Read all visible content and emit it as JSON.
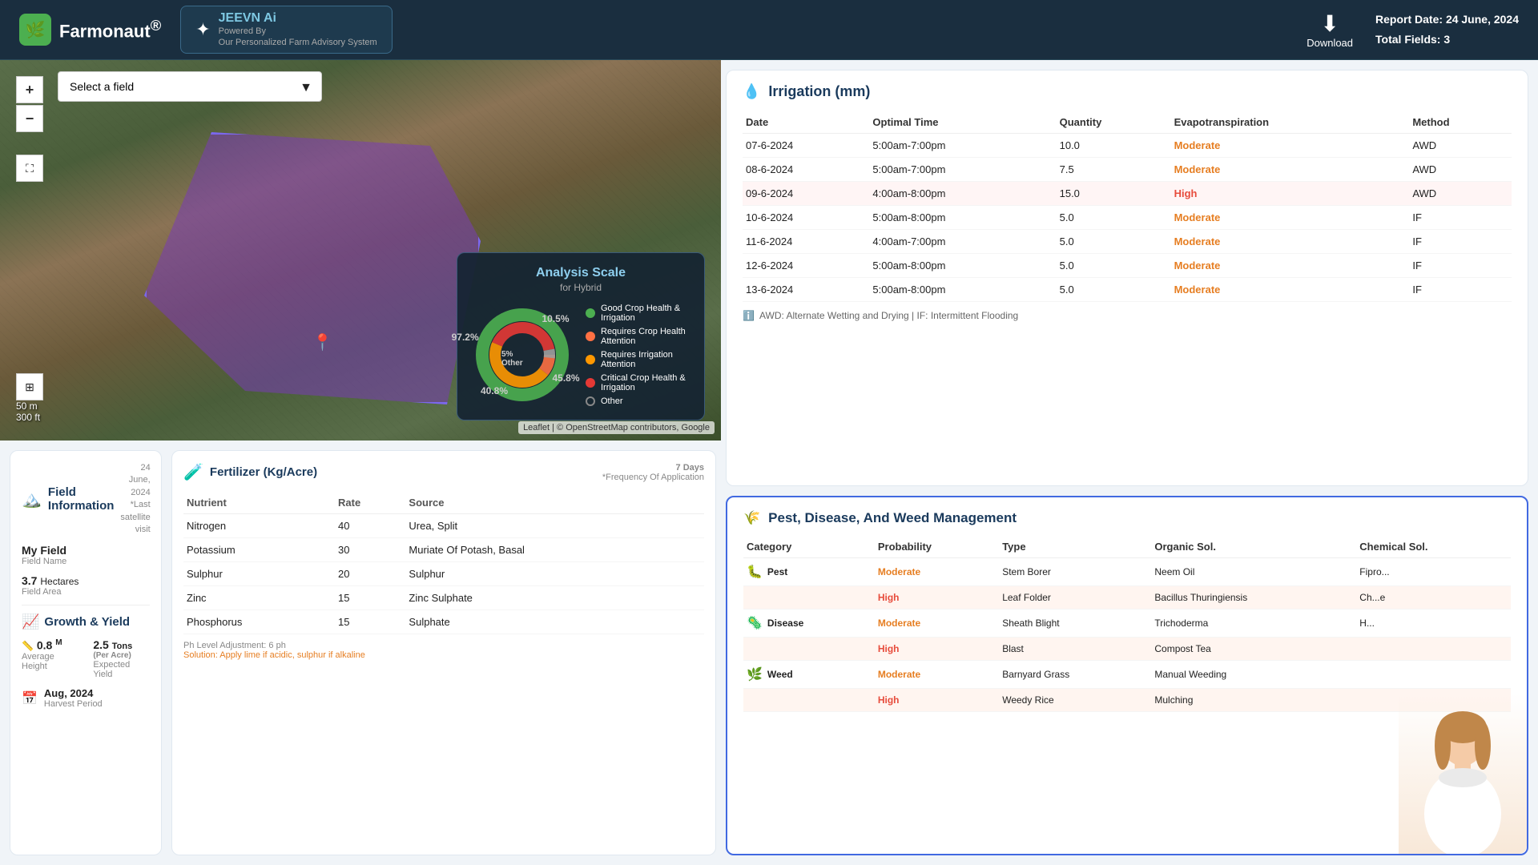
{
  "header": {
    "logo_text": "Farmonaut",
    "logo_reg": "®",
    "jeevn_name": "JEEVN Ai",
    "jeevn_powered": "Powered By",
    "jeevn_desc": "Our Personalized Farm Advisory System",
    "download_label": "Download",
    "report_date_label": "Report Date:",
    "report_date": "24 June, 2024",
    "total_fields_label": "Total Fields:",
    "total_fields": "3"
  },
  "map": {
    "select_placeholder": "Select a field",
    "zoom_in": "+",
    "zoom_out": "−",
    "scale_m": "50 m",
    "scale_ft": "300 ft",
    "credit": "Leaflet | © OpenStreetMap contributors, Google"
  },
  "analysis_scale": {
    "title": "Analysis Scale",
    "subtitle": "for Hybrid",
    "pct_972": "97.2%",
    "pct_105": "10.5%",
    "pct_458": "45.8%",
    "pct_408": "40.8%",
    "pct_5": "5%",
    "pct_5_label": "Other",
    "legend": [
      {
        "label": "Good Crop Health & Irrigation",
        "color": "#4caf50"
      },
      {
        "label": "Requires Crop Health Attention",
        "color": "#ff7043"
      },
      {
        "label": "Requires Irrigation Attention",
        "color": "#ff9800"
      },
      {
        "label": "Critical Crop Health & Irrigation",
        "color": "#e53935"
      },
      {
        "label": "Other",
        "color": "#bdbdbd",
        "outline": true
      }
    ]
  },
  "field_info": {
    "title": "Field Information",
    "date": "24 June, 2024",
    "date_sub": "*Last satellite visit",
    "field_name_label": "Field Name",
    "field_name": "My Field",
    "field_area_label": "Field Area",
    "field_area": "3.7",
    "field_area_unit": "Hectares",
    "growth_title": "Growth & Yield",
    "avg_height_val": "0.8",
    "avg_height_unit": "M",
    "avg_height_label": "Average Height",
    "yield_val": "2.5",
    "yield_unit": "Tons",
    "yield_unit2": "(Per Acre)",
    "yield_label": "Expected Yield",
    "harvest_val": "Aug, 2024",
    "harvest_label": "Harvest Period"
  },
  "fertilizer": {
    "title": "Fertilizer (Kg/Acre)",
    "freq": "7 Days",
    "freq_sub": "*Frequency Of Application",
    "columns": [
      "Nutrient",
      "Rate",
      "Source"
    ],
    "rows": [
      {
        "nutrient": "Nitrogen",
        "rate": "40",
        "source": "Urea, Split"
      },
      {
        "nutrient": "Potassium",
        "rate": "30",
        "source": "Muriate Of Potash, Basal"
      },
      {
        "nutrient": "Sulphur",
        "rate": "20",
        "source": "Sulphur"
      },
      {
        "nutrient": "Zinc",
        "rate": "15",
        "source": "Zinc Sulphate"
      },
      {
        "nutrient": "Phosphorus",
        "rate": "15",
        "source": "Sulphate"
      }
    ],
    "ph_note": "Ph Level Adjustment: 6 ph",
    "ph_solution": "Solution: Apply lime if acidic, sulphur if alkaline"
  },
  "irrigation": {
    "title": "Irrigation (mm)",
    "columns": [
      "Date",
      "Optimal Time",
      "Quantity",
      "Evapotranspiration",
      "Method"
    ],
    "rows": [
      {
        "date": "07-6-2024",
        "time": "5:00am-7:00pm",
        "qty": "10.0",
        "evap": "Moderate",
        "method": "AWD",
        "highlight": false
      },
      {
        "date": "08-6-2024",
        "time": "5:00am-7:00pm",
        "qty": "7.5",
        "evap": "Moderate",
        "method": "AWD",
        "highlight": false
      },
      {
        "date": "09-6-2024",
        "time": "4:00am-8:00pm",
        "qty": "15.0",
        "evap": "High",
        "method": "AWD",
        "highlight": true
      },
      {
        "date": "10-6-2024",
        "time": "5:00am-8:00pm",
        "qty": "5.0",
        "evap": "Moderate",
        "method": "IF",
        "highlight": false
      },
      {
        "date": "11-6-2024",
        "time": "4:00am-7:00pm",
        "qty": "5.0",
        "evap": "Moderate",
        "method": "IF",
        "highlight": false
      },
      {
        "date": "12-6-2024",
        "time": "5:00am-8:00pm",
        "qty": "5.0",
        "evap": "Moderate",
        "method": "IF",
        "highlight": false
      },
      {
        "date": "13-6-2024",
        "time": "5:00am-8:00pm",
        "qty": "5.0",
        "evap": "Moderate",
        "method": "IF",
        "highlight": false
      }
    ],
    "note": "AWD: Alternate Wetting and Drying | IF: Intermittent Flooding"
  },
  "pest": {
    "title": "Pest, Disease, And Weed Management",
    "columns": [
      "Category",
      "Probability",
      "Type",
      "Organic Sol.",
      "Chemical Sol."
    ],
    "categories": [
      {
        "name": "Pest",
        "icon": "🐛",
        "rows": [
          {
            "prob": "Moderate",
            "type": "Stem Borer",
            "organic": "Neem Oil",
            "chemical": "Fipro...",
            "shade": false
          },
          {
            "prob": "High",
            "type": "Leaf Folder",
            "organic": "Bacillus Thuringiensis",
            "chemical": "Ch...e",
            "shade": true
          }
        ]
      },
      {
        "name": "Disease",
        "icon": "🦠",
        "rows": [
          {
            "prob": "Moderate",
            "type": "Sheath Blight",
            "organic": "Trichoderma",
            "chemical": "H...",
            "shade": false
          },
          {
            "prob": "High",
            "type": "Blast",
            "organic": "Compost Tea",
            "chemical": "",
            "shade": true
          }
        ]
      },
      {
        "name": "Weed",
        "icon": "🌿",
        "rows": [
          {
            "prob": "Moderate",
            "type": "Barnyard Grass",
            "organic": "Manual Weeding",
            "chemical": "",
            "shade": false
          },
          {
            "prob": "High",
            "type": "Weedy Rice",
            "organic": "Mulching",
            "chemical": "",
            "shade": true
          }
        ]
      }
    ]
  }
}
